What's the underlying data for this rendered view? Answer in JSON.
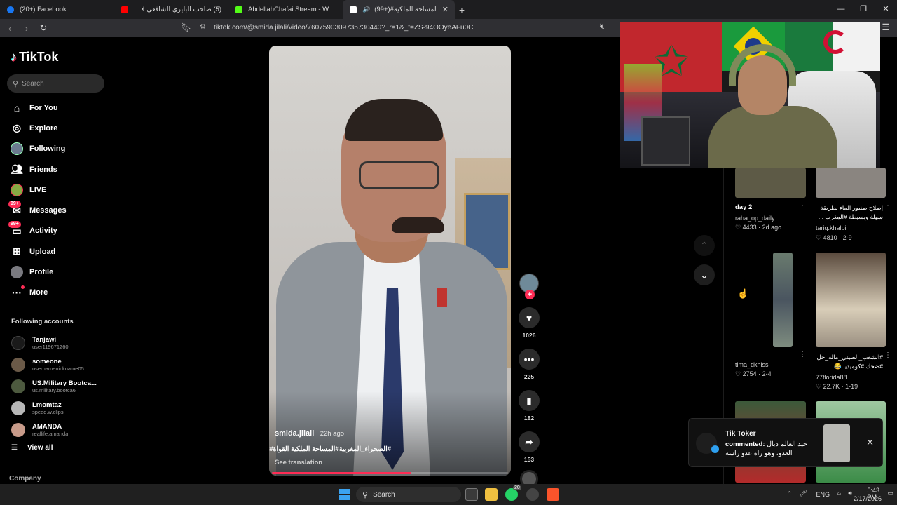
{
  "browser": {
    "tabs": [
      {
        "title": "(20+) Facebook",
        "fav_color": "#1877f2",
        "active": false
      },
      {
        "title": "(5) صاحب البليري الشافعي في الخدمة",
        "fav_color": "#ff0000",
        "active": false
      },
      {
        "title": "AbdellahChafai Stream - Watch Live",
        "fav_color": "#53fc18",
        "active": false
      },
      {
        "title": "(99+)#القواة المساحة الملكية",
        "fav_color": "#ffffff",
        "active": true
      }
    ],
    "new_tab": "+",
    "url": "tiktok.com/@smida.jilali/video/7607590309735730440?_r=1&_t=ZS-94OOyeAFu0C"
  },
  "sidebar": {
    "logo": "TikTok",
    "search_placeholder": "Search",
    "nav": [
      {
        "label": "For You",
        "icon": "home-icon"
      },
      {
        "label": "Explore",
        "icon": "compass-icon"
      },
      {
        "label": "Following",
        "icon": "avatar-icon"
      },
      {
        "label": "Friends",
        "icon": "friends-icon"
      },
      {
        "label": "LIVE",
        "icon": "live-icon"
      },
      {
        "label": "Messages",
        "icon": "messages-icon",
        "badge": "99+"
      },
      {
        "label": "Activity",
        "icon": "activity-icon",
        "badge": "99+"
      },
      {
        "label": "Upload",
        "icon": "upload-icon"
      },
      {
        "label": "Profile",
        "icon": "profile-icon"
      },
      {
        "label": "More",
        "icon": "more-icon"
      }
    ],
    "following_title": "Following accounts",
    "following": [
      {
        "name": "Tanjawi",
        "user": "user119671260",
        "color": "#1a1a1a"
      },
      {
        "name": "someone",
        "user": "usernamenickname05",
        "color": "#6b5a48"
      },
      {
        "name": "US.Military Bootca...",
        "user": "us.military.bootca6",
        "color": "#4d5a3f"
      },
      {
        "name": "Lmomtaz",
        "user": "speed.w.clips",
        "color": "#b7b7b7"
      },
      {
        "name": "AMANDA",
        "user": "reallife.amanda",
        "color": "#c89b8a"
      }
    ],
    "view_all": "View all",
    "company": "Company"
  },
  "video": {
    "author": "smida.jilali",
    "time": " · 22h ago",
    "caption": "#الصحراء_المغربية#المساحة الملكية القواة#",
    "translate": "See translation",
    "progress": 0.59
  },
  "actions": {
    "likes": "1026",
    "comments": "225",
    "saves": "182",
    "shares": "153"
  },
  "recommendations": [
    {
      "title": "day 2",
      "user": "raha_op_daily",
      "stats": "4433 · 2d ago",
      "rtl": false
    },
    {
      "title": "إصلاح صنبور الماء بطريقة سهلة وبسيطة #المغرب ...",
      "user": "tariq.khalbi",
      "stats": "4810 · 2-9",
      "rtl": true
    },
    {
      "title": "",
      "user": "tima_dkhissi",
      "stats": "2754 · 2-4",
      "rtl": false
    },
    {
      "title": "#الشعب_الصيني_ماله_حل #ضحك #كوميديا 😂 ...",
      "user": "77florida88",
      "stats": "22.7K · 1-19",
      "rtl": true
    }
  ],
  "toast": {
    "title": "Tik Toker",
    "label": "commented:",
    "text": "حيد العالم ديال العدو، وهو راه عدو راسه"
  },
  "taskbar": {
    "search": "Search",
    "whatsapp_badge": "20",
    "lang": "ENG",
    "time": "5:43 PM",
    "date": "2/17/2026"
  }
}
